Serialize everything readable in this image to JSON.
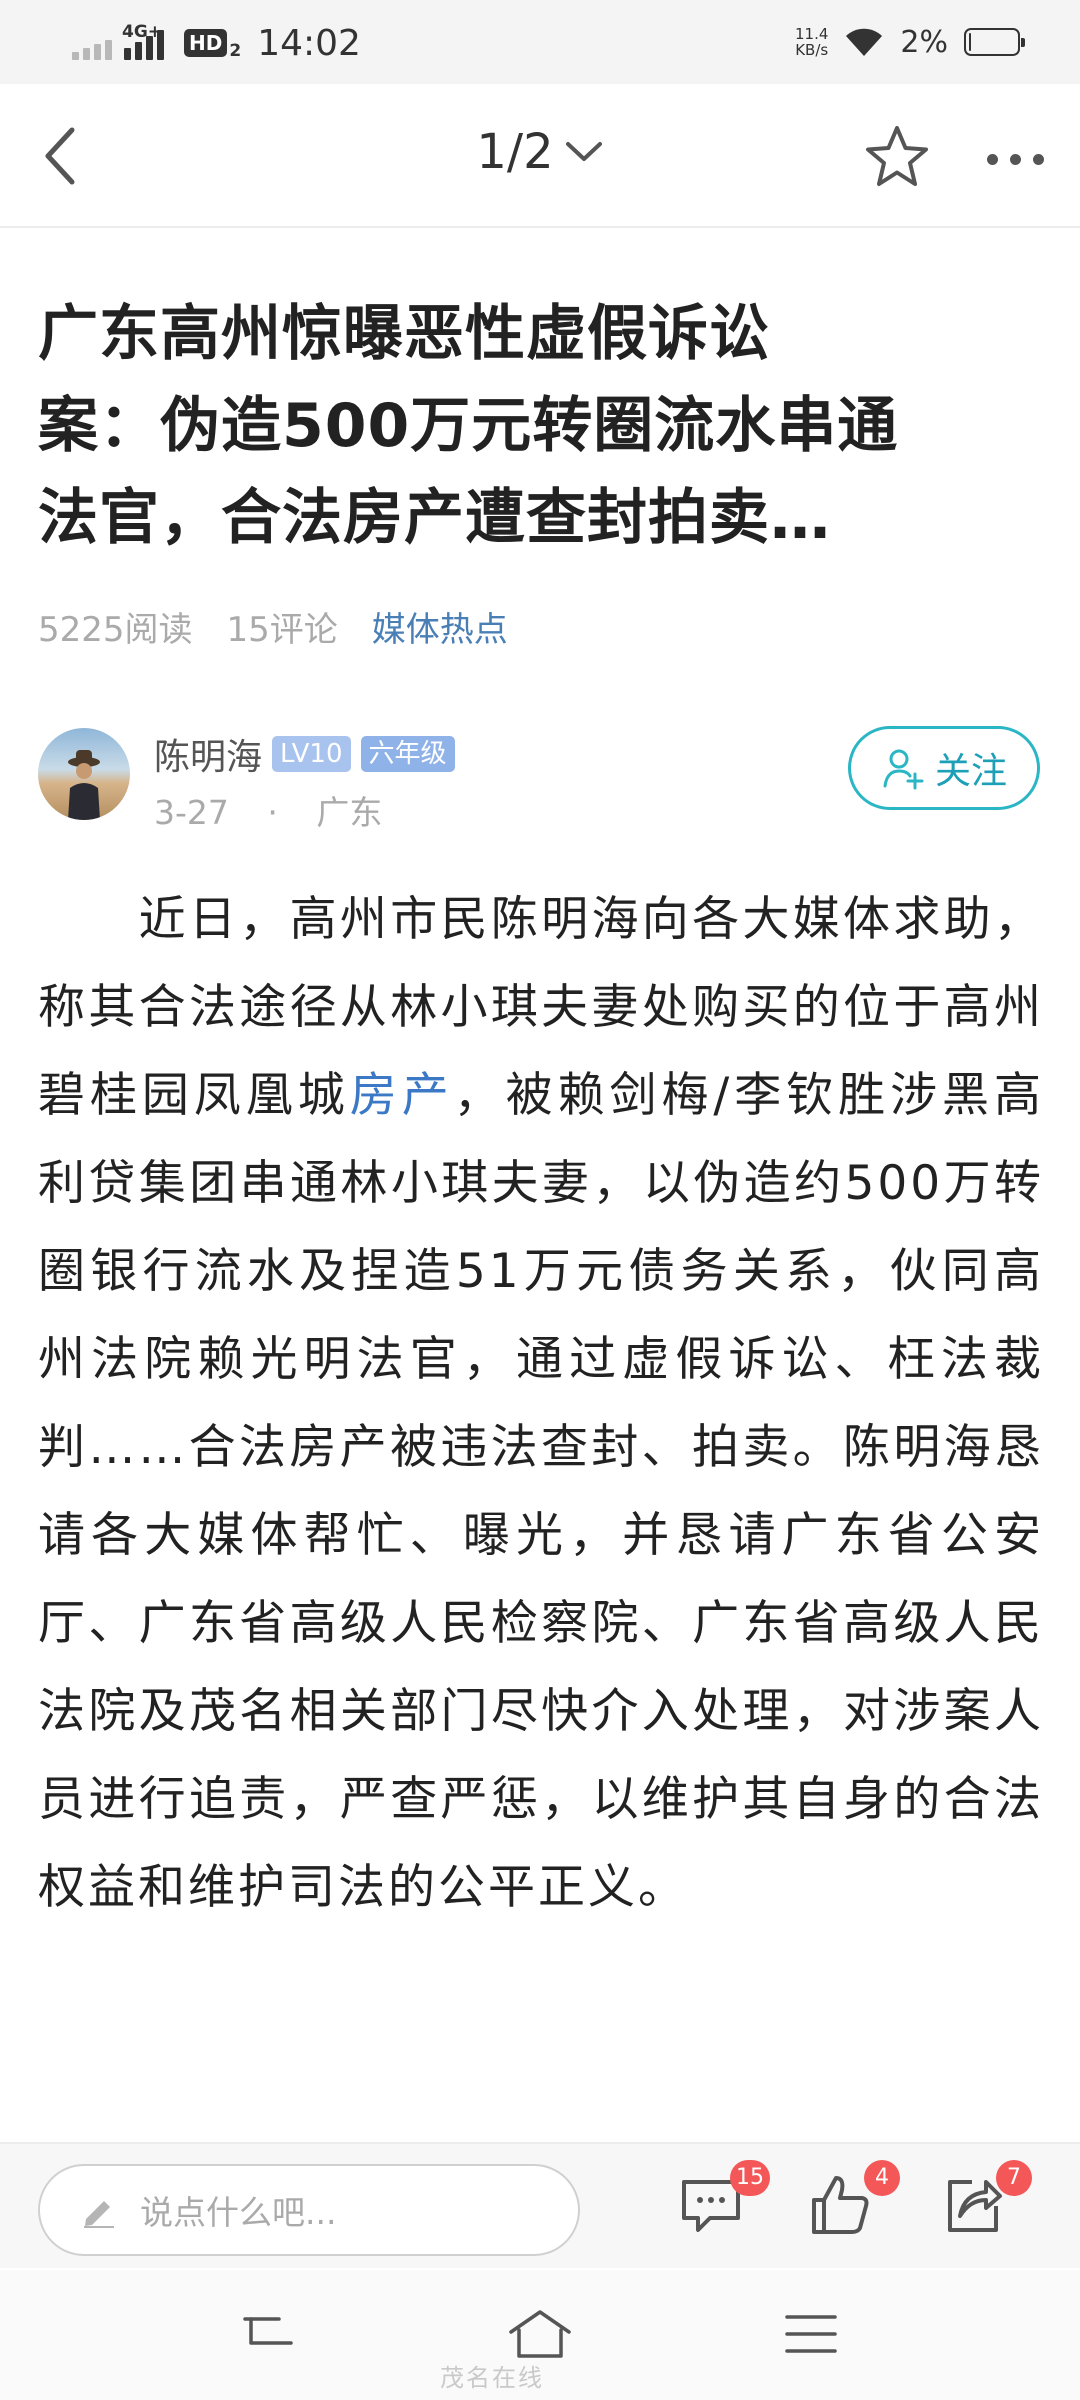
{
  "status_bar": {
    "network": "4G+",
    "hd": "HD",
    "hd_sub": "2",
    "time": "14:02",
    "speed_value": "11.4",
    "speed_unit": "KB/s",
    "battery_pct": "2%",
    "battery_level": 0.02
  },
  "nav": {
    "page_indicator": "1/2",
    "back_icon": "chevron-left-icon",
    "star_icon": "star-outline-icon",
    "more_icon": "more-dots-icon"
  },
  "article": {
    "title_lines": [
      "广东高州惊曝恶性虚假诉讼",
      "案：伪造500万元转圈流水串通",
      "法官，合法房产遭查封拍卖…"
    ],
    "reads": "5225阅读",
    "comments": "15评论",
    "category": "媒体热点",
    "body_before_link": "　　近日，高州市民陈明海向各大媒体求助，称其合法途径从林小琪夫妻处购买的位于高州碧桂园凤凰城",
    "body_link": "房产",
    "body_after_link": "，被赖剑梅/李钦胜涉黑高利贷集团串通林小琪夫妻，以伪造约500万转圈银行流水及捏造51万元债务关系，伙同高州法院赖光明法官，通过虚假诉讼、枉法裁判……合法房产被违法查封、拍卖。陈明海恳请各大媒体帮忙、曝光，并恳请广东省公安厅、广东省高级人民检察院、广东省高级人民法院及茂名相关部门尽快介入处理，对涉案人员进行追责，严查严惩，以维护其自身的合法权益和维护司法的公平正义。"
  },
  "author": {
    "name": "陈明海",
    "level": "LV10",
    "grade": "六年级",
    "date": "3-27",
    "separator": "·",
    "location": "广东",
    "follow_label": "关注"
  },
  "comment_bar": {
    "placeholder": "说点什么吧...",
    "comment_count": "15",
    "like_count": "4",
    "share_count": "7"
  },
  "watermark": "茂名在线"
}
